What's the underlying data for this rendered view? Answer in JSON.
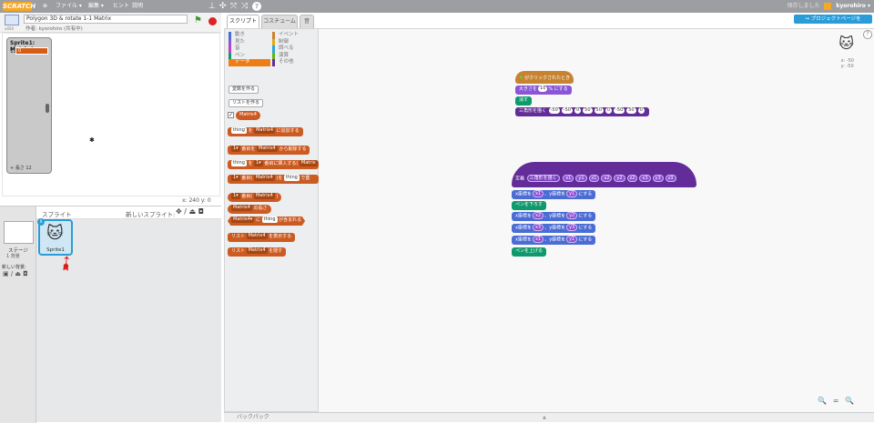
{
  "menubar": {
    "logo": "SCRATCH",
    "globe": "⊕",
    "file": "ファイル ▾",
    "edit": "編集 ▾",
    "tips": "ヒント",
    "about": "説明",
    "tools": [
      "⊥",
      "✣",
      "⤧",
      "⤨",
      "?"
    ],
    "unsaved": "保存しました",
    "user": "kyorohiro ▾"
  },
  "project_page_button": "プロジェクトページを",
  "stage_header": {
    "title": "Polygon 3D & rotate 1-1 Matrix",
    "author": "作者: kyorohiro (共有中)",
    "version": "v450"
  },
  "watcher": {
    "title": "Sprite1: Matrix4",
    "row_index": "12",
    "row_value": "0",
    "footer": "+ 長さ 12"
  },
  "coords": "x: 240  y: 0",
  "sprites": {
    "header": "スプライト",
    "new_sprite": "新しいスプライト:",
    "new_sprite_icons": "✥ / ⏏ ◘",
    "stage_name": "ステージ",
    "stage_bg_count": "1 背景",
    "new_bg": "新しい背景:",
    "new_bg_icons": "▣ / ⏏ ◘",
    "sprite_name": "Sprite1",
    "sprite_info": "i"
  },
  "tabs": [
    "スクリプト",
    "コスチューム",
    "音"
  ],
  "categories": [
    {
      "label": "動き",
      "color": "#4a6cd4"
    },
    {
      "label": "イベント",
      "color": "#c88330"
    },
    {
      "label": "見た",
      "color": "#8a55d7"
    },
    {
      "label": "制御",
      "color": "#e1a91a"
    },
    {
      "label": "音",
      "color": "#bb42c3"
    },
    {
      "label": "調べる",
      "color": "#2ca5e2"
    },
    {
      "label": "ペン",
      "color": "#0e9a6c"
    },
    {
      "label": "演算",
      "color": "#5cb712"
    },
    {
      "label": "データ",
      "color": "#ee7d16"
    },
    {
      "label": "その他",
      "color": "#632d99"
    }
  ],
  "palette": {
    "make_var": "変数を作る",
    "make_list": "リストを作る",
    "list_reporter": "Matrix4",
    "blocks": {
      "add_thing": "thing",
      "add_mid": "を",
      "add_list": "Matrix4",
      "add_end": "に追加する",
      "del_num": "1▾",
      "del_mid": "番目を",
      "del_list": "Matrix4",
      "del_end": "から削除する",
      "ins_thing": "thing",
      "ins_mid": "を",
      "ins_num": "1▾",
      "ins_mid2": "番目に挿入する(",
      "ins_list": "Matrix",
      "rep_num": "1▾",
      "rep_mid": "番目(",
      "rep_list": "Matrix4",
      "rep_mid2": ")を",
      "rep_thing": "thing",
      "rep_end": "で置",
      "item_num": "1▾",
      "item_mid": "番目(",
      "item_list": "Matrix4",
      "item_end": ")",
      "len_list": "Matrix4",
      "len_end": "の長さ",
      "cont_list": "Matrix4▾",
      "cont_mid": "に",
      "cont_thing": "thing",
      "cont_end": "が含まれる",
      "show_pre": "リスト",
      "show_list": "Matrix4",
      "show_end": "を表示する",
      "hide_pre": "リスト",
      "hide_list": "Matrix4",
      "hide_end": "を隠す"
    }
  },
  "script1": {
    "hat": "がクリックされたとき",
    "size_pre": "大きさを",
    "size_val": "10",
    "size_end": "% にする",
    "clear": "消す",
    "tri_label": "三角形を描く",
    "tri_args": [
      "-50",
      "-50",
      "0",
      "50",
      "50",
      "0",
      "-50",
      "50",
      "0"
    ]
  },
  "script2": {
    "define": "定義",
    "define_name": "三角形を描く",
    "define_args": [
      "x1",
      "y1",
      "z1",
      "x2",
      "y2",
      "z2",
      "x3",
      "y3",
      "z3"
    ],
    "rows": [
      {
        "type": "motion",
        "pre": "x座標を",
        "a": "x1",
        "mid": "、y座標を",
        "b": "y1",
        "end": "にする"
      },
      {
        "type": "pen",
        "text": "ペンを下ろす"
      },
      {
        "type": "motion",
        "pre": "x座標を",
        "a": "x2",
        "mid": "、y座標を",
        "b": "y2",
        "end": "にする"
      },
      {
        "type": "motion",
        "pre": "x座標を",
        "a": "x3",
        "mid": "、y座標を",
        "b": "y3",
        "end": "にする"
      },
      {
        "type": "motion",
        "pre": "x座標を",
        "a": "x1",
        "mid": "、y座標を",
        "b": "y1",
        "end": "にする"
      },
      {
        "type": "pen",
        "text": "ペンを上げる"
      }
    ]
  },
  "script_area": {
    "xy": [
      "x: -50",
      "y: -50"
    ],
    "zoom": "🔍 = 🔍",
    "help": "?"
  },
  "backpack": "バックパック"
}
